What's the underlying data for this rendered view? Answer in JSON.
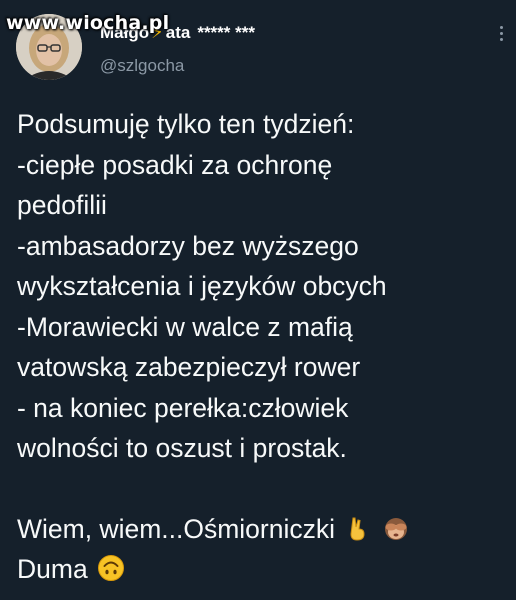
{
  "watermark": "www.wiocha.pl",
  "author": {
    "name_part1": "Małgo",
    "name_part2": "ata",
    "name_stars": "***** ***",
    "handle": "@szlgocha"
  },
  "icons": {
    "bolt": "high-voltage-emoji",
    "more": "more-options-icon",
    "hand": "victory-hand-emoji",
    "monkey": "see-no-evil-monkey-emoji",
    "face": "upside-down-face-emoji"
  },
  "colors": {
    "background": "#15202b",
    "text": "#f7f9f9",
    "secondary": "#8b98a5",
    "bolt": "#f5b800"
  },
  "tweet": {
    "lines": [
      "Podsumuję tylko ten tydzień:",
      "-ciepłe posadki za ochronę",
      "pedofilii",
      "-ambasadorzy bez wyższego",
      "wykształcenia i języków obcych",
      "-Morawiecki w walce z mafią",
      "vatowską zabezpieczył rower",
      "- na koniec perełka:człowiek",
      "wolności to oszust i prostak."
    ],
    "closing_line1": "Wiem, wiem...Ośmiorniczki",
    "closing_line2": "Duma"
  }
}
